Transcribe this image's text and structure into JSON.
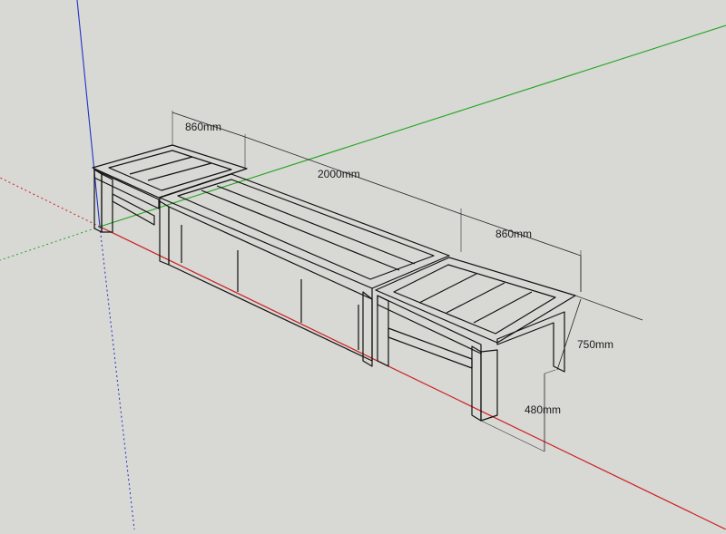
{
  "scene": {
    "background": "#d8d8d4",
    "axis_colors": {
      "red": "#cc1f1f",
      "green": "#1fa51f",
      "blue": "#2230c8"
    },
    "face_colors": {
      "top": "#8c8c8c",
      "panel": "#9a9a9a",
      "light": "#f2f2f2",
      "side": "#e6e6e6"
    }
  },
  "dimensions": {
    "left_width": "860mm",
    "middle_length": "2000mm",
    "right_width": "860mm",
    "depth": "750mm",
    "height": "480mm"
  }
}
